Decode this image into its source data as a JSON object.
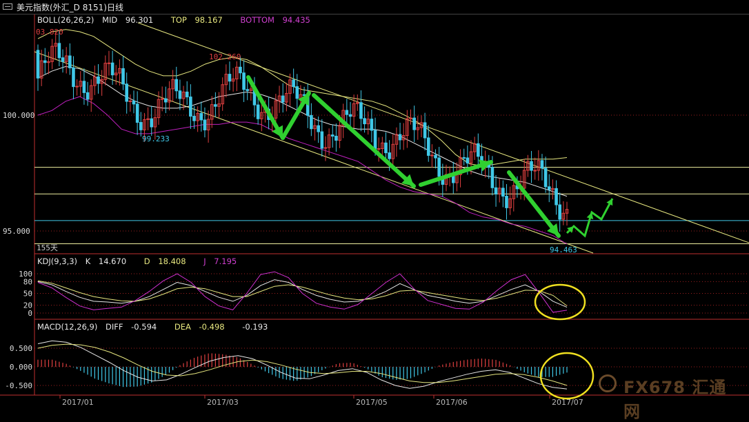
{
  "window": {
    "title": "美元指数(外汇_D 8151)日线"
  },
  "main_legend": {
    "indicator": "BOLL(26,26,2)",
    "mid_label": "MID",
    "mid_value": "96.301",
    "top_label": "TOP",
    "top_value": "98.167",
    "bottom_label": "BOTTOM",
    "bottom_value": "94.435"
  },
  "kdj_legend": {
    "indicator": "KDJ(9,3,3)",
    "k_label": "K",
    "k_value": "14.670",
    "d_label": "D",
    "d_value": "18.408",
    "j_label": "J",
    "j_value": "7.195"
  },
  "macd_legend": {
    "indicator": "MACD(12,26,9)",
    "diff_label": "DIFF",
    "diff_value": "-0.594",
    "dea_label": "DEA",
    "dea_value": "-0.498",
    "macd_value": "-0.193"
  },
  "price_annotations": {
    "left_high": "03.820",
    "peak_high": "102.260",
    "low_1": "99.233",
    "low_last": "94.463",
    "period_label": "155天"
  },
  "watermark": {
    "text": "FX678 汇通网"
  },
  "colors": {
    "up": "#e04040",
    "down": "#40c8e8",
    "mid": "#e8e8e8",
    "top": "#e8e880",
    "bottom": "#c020c0",
    "arrow": "#30d030",
    "channel": "#e8e880",
    "hline": "#f0f0a0",
    "macd_pos": "#e04040",
    "macd_neg": "#40c8e8",
    "highlight": "#f0e020"
  },
  "chart_data": [
    {
      "type": "candlestick",
      "title": "美元指数(外汇_D 8151)日线",
      "x_ticks": [
        "2017/01",
        "2017/03",
        "2017/05",
        "2017/06",
        "2017/07"
      ],
      "y_ticks": [
        "100.000",
        "95.000"
      ],
      "ylim": [
        94.4,
        103.8
      ],
      "horizontal_levels": [
        97.75,
        96.6,
        95.45,
        94.45
      ],
      "series": [
        {
          "name": "MID",
          "values": [
            101.6,
            101.9,
            102.1,
            102.0,
            101.7,
            101.3,
            100.9,
            100.6,
            100.4,
            100.3,
            100.3,
            100.4,
            100.6,
            100.8,
            100.9,
            101.0,
            100.9,
            100.7,
            100.4,
            100.1,
            99.8,
            99.6,
            99.5,
            99.4,
            99.4,
            99.3,
            99.1,
            98.8,
            98.5,
            98.2,
            97.9,
            97.6,
            97.4,
            97.3,
            97.2,
            97.1,
            96.9,
            96.7,
            96.5
          ]
        },
        {
          "name": "TOP",
          "values": [
            103.3,
            103.6,
            103.7,
            103.6,
            103.4,
            103.0,
            102.6,
            102.2,
            101.9,
            101.7,
            101.7,
            101.9,
            102.2,
            102.4,
            102.5,
            102.4,
            102.1,
            101.7,
            101.3,
            101.1,
            101.0,
            100.9,
            100.8,
            100.7,
            100.6,
            100.4,
            100.1,
            99.8,
            99.4,
            98.9,
            98.3,
            97.9,
            97.8,
            97.9,
            98.0,
            98.1,
            98.1,
            98.1,
            98.17
          ]
        },
        {
          "name": "BOTTOM",
          "values": [
            100.0,
            100.2,
            100.6,
            100.8,
            100.5,
            100.0,
            99.4,
            99.2,
            99.2,
            99.3,
            99.4,
            99.5,
            99.6,
            99.6,
            99.7,
            99.7,
            99.6,
            99.3,
            99.0,
            98.8,
            98.6,
            98.4,
            98.2,
            98.0,
            97.6,
            97.2,
            96.9,
            96.7,
            96.6,
            96.5,
            96.2,
            95.8,
            95.6,
            95.5,
            95.3,
            95.2,
            95.0,
            94.8,
            94.435
          ]
        }
      ]
    },
    {
      "type": "line",
      "title": "KDJ(9,3,3)",
      "y_ticks": [
        "100",
        "80",
        "50",
        "20",
        "0"
      ],
      "ylim": [
        -5,
        110
      ],
      "series": [
        {
          "name": "K",
          "values": [
            80,
            72,
            55,
            40,
            30,
            28,
            25,
            30,
            42,
            60,
            78,
            70,
            55,
            40,
            30,
            45,
            70,
            85,
            78,
            60,
            45,
            35,
            28,
            30,
            40,
            55,
            75,
            60,
            45,
            38,
            30,
            25,
            30,
            45,
            60,
            72,
            55,
            30,
            14.67
          ]
        },
        {
          "name": "D",
          "values": [
            82,
            76,
            64,
            52,
            42,
            36,
            31,
            30,
            36,
            48,
            62,
            66,
            62,
            52,
            42,
            42,
            55,
            68,
            72,
            66,
            56,
            46,
            38,
            34,
            36,
            44,
            56,
            58,
            52,
            46,
            40,
            34,
            32,
            38,
            48,
            58,
            57,
            45,
            18.41
          ]
        },
        {
          "name": "J",
          "values": [
            78,
            64,
            40,
            18,
            8,
            12,
            15,
            32,
            55,
            82,
            100,
            78,
            42,
            18,
            8,
            50,
            98,
            105,
            90,
            50,
            25,
            15,
            10,
            22,
            50,
            78,
            100,
            62,
            32,
            22,
            12,
            10,
            28,
            58,
            85,
            98,
            52,
            2,
            7.195
          ]
        }
      ]
    },
    {
      "type": "bar",
      "title": "MACD(12,26,9)",
      "y_ticks": [
        "0.500",
        "0.000",
        "-0.500"
      ],
      "ylim": [
        -0.7,
        0.8
      ],
      "series": [
        {
          "name": "DIFF",
          "values": [
            0.62,
            0.7,
            0.66,
            0.52,
            0.32,
            0.12,
            -0.1,
            -0.28,
            -0.38,
            -0.35,
            -0.2,
            -0.02,
            0.15,
            0.25,
            0.3,
            0.22,
            0.05,
            -0.15,
            -0.3,
            -0.32,
            -0.22,
            -0.1,
            -0.05,
            -0.15,
            -0.35,
            -0.5,
            -0.58,
            -0.52,
            -0.4,
            -0.3,
            -0.2,
            -0.12,
            -0.08,
            -0.15,
            -0.3,
            -0.45,
            -0.55,
            -0.594
          ]
        },
        {
          "name": "DEA",
          "values": [
            0.5,
            0.58,
            0.61,
            0.59,
            0.52,
            0.4,
            0.24,
            0.05,
            -0.12,
            -0.22,
            -0.24,
            -0.18,
            -0.08,
            0.04,
            0.14,
            0.18,
            0.14,
            0.05,
            -0.06,
            -0.15,
            -0.18,
            -0.16,
            -0.12,
            -0.12,
            -0.18,
            -0.28,
            -0.38,
            -0.42,
            -0.42,
            -0.38,
            -0.32,
            -0.26,
            -0.2,
            -0.18,
            -0.21,
            -0.28,
            -0.38,
            -0.498
          ]
        }
      ]
    }
  ]
}
